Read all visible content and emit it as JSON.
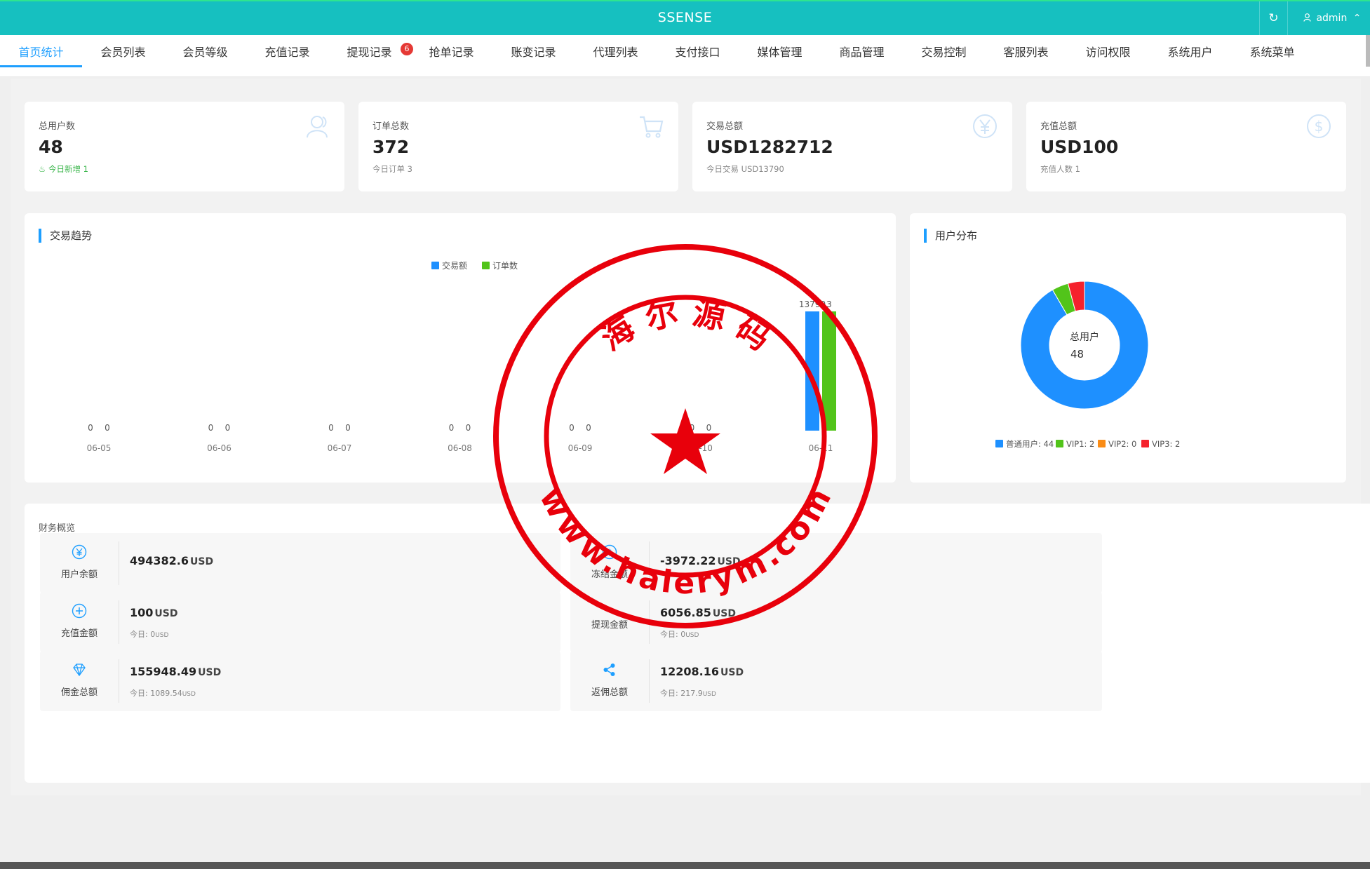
{
  "header": {
    "brand": "SSENSE",
    "refresh_icon": "refresh-icon",
    "user": "admin"
  },
  "nav": {
    "tabs": [
      {
        "label": "首页统计",
        "active": true
      },
      {
        "label": "会员列表"
      },
      {
        "label": "会员等级"
      },
      {
        "label": "充值记录"
      },
      {
        "label": "提现记录",
        "badge": "6"
      },
      {
        "label": "抢单记录"
      },
      {
        "label": "账变记录"
      },
      {
        "label": "代理列表"
      },
      {
        "label": "支付接口"
      },
      {
        "label": "媒体管理"
      },
      {
        "label": "商品管理"
      },
      {
        "label": "交易控制"
      },
      {
        "label": "客服列表"
      },
      {
        "label": "访问权限"
      },
      {
        "label": "系统用户"
      },
      {
        "label": "系统菜单"
      }
    ]
  },
  "stats": [
    {
      "label": "总用户数",
      "value": "48",
      "sub": "今日新增 1",
      "icon": "user-icon"
    },
    {
      "label": "订单总数",
      "value": "372",
      "sub": "今日订单 3",
      "icon": "cart-icon"
    },
    {
      "label": "交易总额",
      "value": "USD1282712",
      "sub": "今日交易 USD13790",
      "icon": "yen-icon"
    },
    {
      "label": "充值总额",
      "value": "USD100",
      "sub": "充值人数 1",
      "icon": "dollar-icon"
    }
  ],
  "trend": {
    "title": "交易趋势",
    "legend": [
      "交易额",
      "订单数"
    ],
    "colors": [
      "#1e90ff",
      "#52c41a"
    ]
  },
  "distribution": {
    "title": "用户分布",
    "center_label": "总用户",
    "center_value": "48",
    "legend": [
      "普通用户: 44",
      "VIP1: 2",
      "VIP2: 0",
      "VIP3: 2"
    ],
    "colors": [
      "#1e90ff",
      "#52c41a",
      "#fa8c16",
      "#f5222d"
    ]
  },
  "chart_data": [
    {
      "type": "bar",
      "title": "交易趋势",
      "categories": [
        "06-05",
        "06-06",
        "06-07",
        "06-08",
        "06-09",
        "06-10",
        "06-11"
      ],
      "series": [
        {
          "name": "交易额",
          "values": [
            0,
            0,
            0,
            0,
            0,
            0,
            13790
          ]
        },
        {
          "name": "订单数",
          "values": [
            0,
            0,
            0,
            0,
            0,
            0,
            3
          ]
        }
      ],
      "legend": "top-center",
      "grid": false
    },
    {
      "type": "pie",
      "title": "用户分布",
      "labels": [
        "普通用户",
        "VIP1",
        "VIP2",
        "VIP3"
      ],
      "values": [
        44,
        2,
        0,
        2
      ],
      "legend": "bottom"
    }
  ],
  "finance": {
    "title": "财务概览",
    "items": [
      {
        "label": "用户余额",
        "amount": "494382.6",
        "unit": "USD",
        "icon": "yen-circle-icon"
      },
      {
        "label": "冻结金额",
        "amount": "-3972.22",
        "unit": "USD",
        "icon": "dollar-circle-icon"
      },
      {
        "label": "充值金额",
        "amount": "100",
        "unit": "USD",
        "today_label": "今日:",
        "today_value": "0",
        "today_unit": "USD",
        "icon": "plus-circle-icon"
      },
      {
        "label": "提现金额",
        "amount": "6056.85",
        "unit": "USD",
        "today_label": "今日:",
        "today_value": "0",
        "today_unit": "USD",
        "icon": "withdraw-icon"
      },
      {
        "label": "佣金总额",
        "amount": "155948.49",
        "unit": "USD",
        "today_label": "今日:",
        "today_value": "1089.54",
        "today_unit": "USD",
        "icon": "diamond-icon"
      },
      {
        "label": "返佣总额",
        "amount": "12208.16",
        "unit": "USD",
        "today_label": "今日:",
        "today_value": "217.9",
        "today_unit": "USD",
        "icon": "share-icon"
      }
    ]
  },
  "stamp": {
    "top_text": "海 尔 源 码",
    "bottom_text": "www.haierym.com",
    "color": "#e8000b"
  }
}
